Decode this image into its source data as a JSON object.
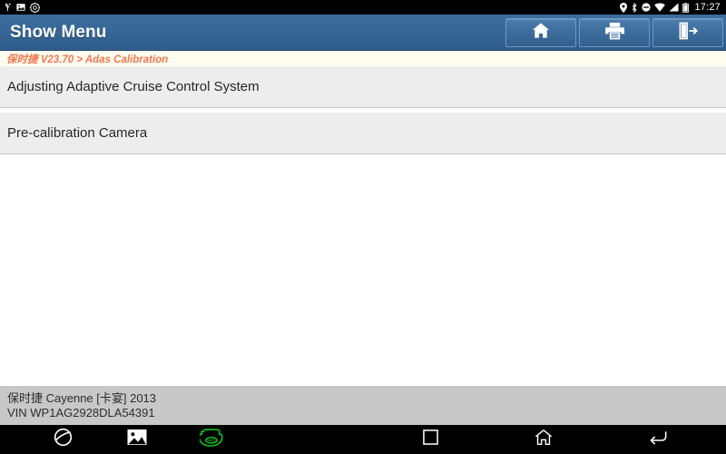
{
  "statusbar": {
    "time": "17:27",
    "left_icons": [
      "usb-debug-icon",
      "screenshot-icon",
      "settings-gear-icon"
    ],
    "right_icons": [
      "location-pin-icon",
      "bluetooth-icon",
      "do-not-disturb-icon",
      "wifi-icon",
      "cellular-signal-icon",
      "battery-icon"
    ]
  },
  "titlebar": {
    "title": "Show Menu",
    "buttons": [
      {
        "name": "home-button",
        "icon": "home-icon"
      },
      {
        "name": "print-button",
        "icon": "printer-icon"
      },
      {
        "name": "exit-button",
        "icon": "exit-door-icon"
      }
    ]
  },
  "breadcrumb": {
    "text": "保时捷 V23.70 > Adas Calibration"
  },
  "menu": {
    "items": [
      {
        "label": "Adjusting Adaptive Cruise Control System"
      },
      {
        "label": "Pre-calibration Camera"
      }
    ]
  },
  "footer": {
    "vehicle": "保时捷 Cayenne [卡宴] 2013",
    "vin": "VIN WP1AG2928DLA54391"
  },
  "navbar": {
    "left_items": [
      {
        "name": "browser-icon"
      },
      {
        "name": "gallery-icon"
      },
      {
        "name": "vci-connector-icon"
      }
    ],
    "right_items": [
      {
        "name": "recents-square-icon"
      },
      {
        "name": "home-outline-icon"
      },
      {
        "name": "back-arrow-icon"
      }
    ]
  },
  "colors": {
    "titlebar_top": "#3d6d9e",
    "titlebar_bottom": "#2f5c89",
    "breadcrumb_text": "#f4764f",
    "breadcrumb_bg": "#fffdf0",
    "menu_row_bg": "#ededed",
    "footer_bg": "#c8c8c8",
    "vci_green": "#16c416",
    "navbar_bg": "#000000"
  }
}
